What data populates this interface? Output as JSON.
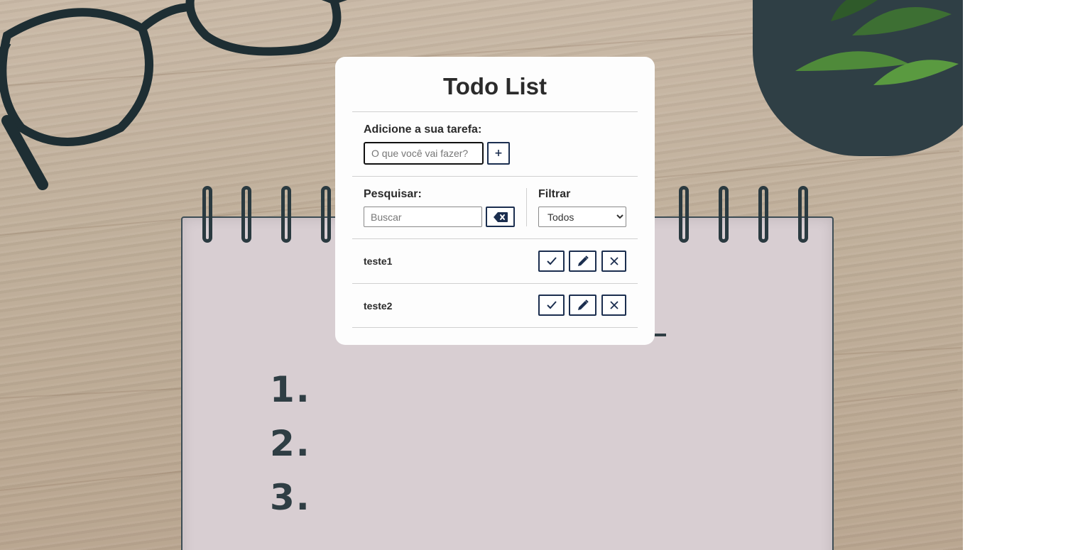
{
  "app": {
    "title": "Todo List"
  },
  "add_section": {
    "label": "Adicione a sua tarefa:",
    "input_placeholder": "O que você vai fazer?",
    "input_value": "",
    "add_button_label": "+"
  },
  "search_section": {
    "label": "Pesquisar:",
    "input_placeholder": "Buscar",
    "input_value": "",
    "clear_icon": "backspace-icon"
  },
  "filter_section": {
    "label": "Filtrar",
    "selected": "Todos",
    "options": [
      "Todos"
    ]
  },
  "todos": [
    {
      "text": "teste1",
      "done_icon": "check-icon",
      "edit_icon": "pencil-icon",
      "remove_icon": "close-icon"
    },
    {
      "text": "teste2",
      "done_icon": "check-icon",
      "edit_icon": "pencil-icon",
      "remove_icon": "close-icon"
    }
  ],
  "background": {
    "list_numbers": [
      "1.",
      "2.",
      "3."
    ]
  },
  "colors": {
    "accent": "#1b2e4f",
    "card": "#fdfdfd",
    "text": "#2b2b2b"
  }
}
